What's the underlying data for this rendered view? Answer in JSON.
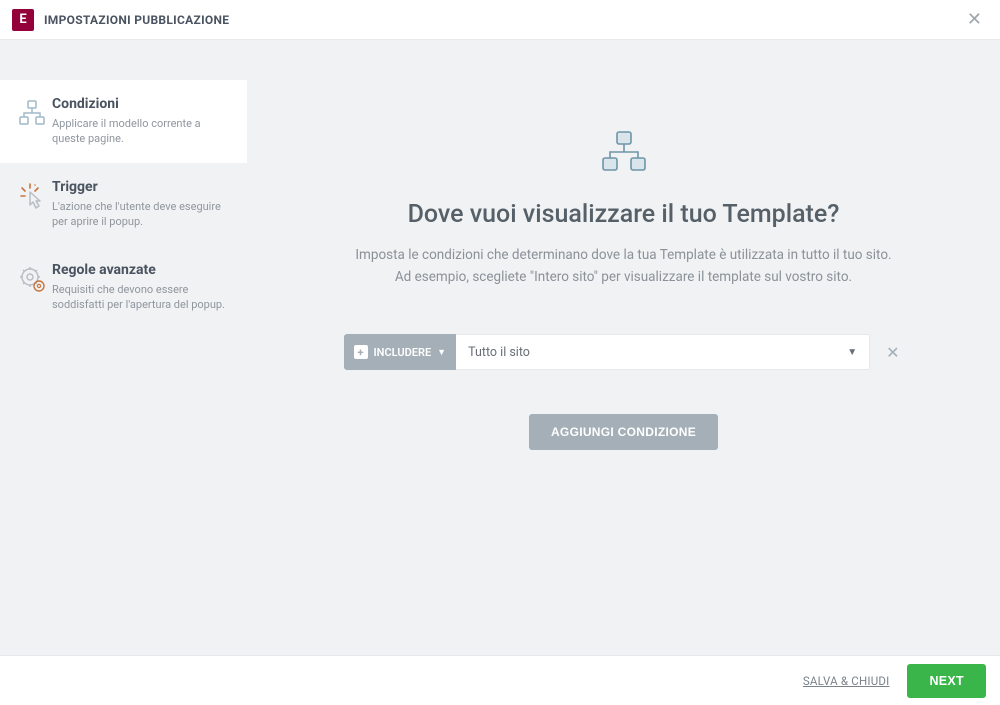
{
  "header": {
    "logo_letter": "E",
    "title": "IMPOSTAZIONI PUBBLICAZIONE"
  },
  "sidebar": {
    "items": [
      {
        "title": "Condizioni",
        "desc": "Applicare il modello corrente a queste pagine."
      },
      {
        "title": "Trigger",
        "desc": "L'azione che l'utente deve eseguire per aprire il popup."
      },
      {
        "title": "Regole avanzate",
        "desc": "Requisiti che devono essere soddisfatti per l'apertura del popup."
      }
    ]
  },
  "main": {
    "heading": "Dove vuoi visualizzare il tuo Template?",
    "sub1": "Imposta le condizioni che determinano dove la tua Template è utilizzata in tutto il tuo sito.",
    "sub2": "Ad esempio, scegliete \"Intero sito\" per visualizzare il template sul vostro sito.",
    "include_label": "INCLUDERE",
    "select_value": "Tutto il sito",
    "add_button": "AGGIUNGI CONDIZIONE"
  },
  "footer": {
    "save_close": "SALVA & CHIUDI",
    "next": "NEXT"
  }
}
